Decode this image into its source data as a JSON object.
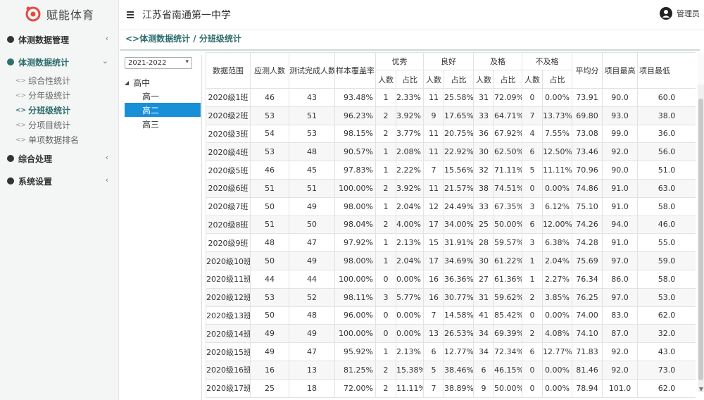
{
  "app": {
    "name": "赋能体育"
  },
  "header": {
    "school": "江苏省南通第一中学",
    "user": "管理员"
  },
  "menu": [
    {
      "label": "体测数据管理",
      "expanded": false,
      "active": false
    },
    {
      "label": "体测数据统计",
      "expanded": true,
      "active": true,
      "children": [
        {
          "label": "综合性统计",
          "active": false
        },
        {
          "label": "分年级统计",
          "active": false
        },
        {
          "label": "分班级统计",
          "active": true
        },
        {
          "label": "分项目统计",
          "active": false
        },
        {
          "label": "单项数据排名",
          "active": false
        }
      ]
    },
    {
      "label": "综合处理",
      "expanded": false,
      "active": false
    },
    {
      "label": "系统设置",
      "expanded": false,
      "active": false
    }
  ],
  "breadcrumb": "体测数据统计 / 分班级统计",
  "year_select": {
    "value": "2021-2022"
  },
  "tree": {
    "root": "高中",
    "nodes": [
      {
        "label": "高一",
        "selected": false
      },
      {
        "label": "高二",
        "selected": true
      },
      {
        "label": "高三",
        "selected": false
      }
    ]
  },
  "table": {
    "headers": {
      "range": "数据范围",
      "should": "应测人数",
      "done": "测试完成人数",
      "coverage": "样本覆盖率",
      "excellent": "优秀",
      "good": "良好",
      "pass": "及格",
      "fail": "不及格",
      "avg": "平均分",
      "max": "项目最高",
      "min": "项目最低",
      "count": "人数",
      "ratio": "占比"
    },
    "rows": [
      [
        "2020级1班",
        "46",
        "43",
        "93.48%",
        "1",
        "2.33%",
        "11",
        "25.58%",
        "31",
        "72.09%",
        "0",
        "0.00%",
        "73.91",
        "90.0",
        "60.0"
      ],
      [
        "2020级2班",
        "53",
        "51",
        "96.23%",
        "2",
        "3.92%",
        "9",
        "17.65%",
        "33",
        "64.71%",
        "7",
        "13.73%",
        "69.80",
        "93.0",
        "38.0"
      ],
      [
        "2020级3班",
        "54",
        "53",
        "98.15%",
        "2",
        "3.77%",
        "11",
        "20.75%",
        "36",
        "67.92%",
        "4",
        "7.55%",
        "73.08",
        "99.0",
        "36.0"
      ],
      [
        "2020级4班",
        "53",
        "48",
        "90.57%",
        "1",
        "2.08%",
        "11",
        "22.92%",
        "30",
        "62.50%",
        "6",
        "12.50%",
        "73.46",
        "92.0",
        "56.0"
      ],
      [
        "2020级5班",
        "46",
        "45",
        "97.83%",
        "1",
        "2.22%",
        "7",
        "15.56%",
        "32",
        "71.11%",
        "5",
        "11.11%",
        "70.96",
        "90.0",
        "51.0"
      ],
      [
        "2020级6班",
        "51",
        "51",
        "100.00%",
        "2",
        "3.92%",
        "11",
        "21.57%",
        "38",
        "74.51%",
        "0",
        "0.00%",
        "74.86",
        "91.0",
        "63.0"
      ],
      [
        "2020级7班",
        "50",
        "49",
        "98.00%",
        "1",
        "2.04%",
        "12",
        "24.49%",
        "33",
        "67.35%",
        "3",
        "6.12%",
        "75.10",
        "91.0",
        "58.0"
      ],
      [
        "2020级8班",
        "51",
        "50",
        "98.04%",
        "2",
        "4.00%",
        "17",
        "34.00%",
        "25",
        "50.00%",
        "6",
        "12.00%",
        "74.26",
        "94.0",
        "46.0"
      ],
      [
        "2020级9班",
        "48",
        "47",
        "97.92%",
        "1",
        "2.13%",
        "15",
        "31.91%",
        "28",
        "59.57%",
        "3",
        "6.38%",
        "74.28",
        "91.0",
        "55.0"
      ],
      [
        "2020级10班",
        "50",
        "49",
        "98.00%",
        "1",
        "2.04%",
        "17",
        "34.69%",
        "30",
        "61.22%",
        "1",
        "2.04%",
        "75.69",
        "97.0",
        "59.0"
      ],
      [
        "2020级11班",
        "44",
        "44",
        "100.00%",
        "0",
        "0.00%",
        "16",
        "36.36%",
        "27",
        "61.36%",
        "1",
        "2.27%",
        "76.34",
        "86.0",
        "58.0"
      ],
      [
        "2020级12班",
        "53",
        "52",
        "98.11%",
        "3",
        "5.77%",
        "16",
        "30.77%",
        "31",
        "59.62%",
        "2",
        "3.85%",
        "76.25",
        "97.0",
        "53.0"
      ],
      [
        "2020级13班",
        "50",
        "48",
        "96.00%",
        "0",
        "0.00%",
        "7",
        "14.58%",
        "41",
        "85.42%",
        "0",
        "0.00%",
        "74.00",
        "83.0",
        "62.0"
      ],
      [
        "2020级14班",
        "49",
        "49",
        "100.00%",
        "0",
        "0.00%",
        "13",
        "26.53%",
        "34",
        "69.39%",
        "2",
        "4.08%",
        "74.10",
        "87.0",
        "32.0"
      ],
      [
        "2020级15班",
        "49",
        "47",
        "95.92%",
        "1",
        "2.13%",
        "6",
        "12.77%",
        "34",
        "72.34%",
        "6",
        "12.77%",
        "71.83",
        "92.0",
        "43.0"
      ],
      [
        "2020级16班",
        "16",
        "13",
        "81.25%",
        "2",
        "15.38%",
        "5",
        "38.46%",
        "6",
        "46.15%",
        "0",
        "0.00%",
        "81.46",
        "92.0",
        "73.0"
      ],
      [
        "2020级17班",
        "25",
        "18",
        "72.00%",
        "2",
        "11.11%",
        "7",
        "38.89%",
        "9",
        "50.00%",
        "0",
        "0.00%",
        "78.94",
        "101.0",
        "62.0"
      ]
    ]
  },
  "icons": {
    "logo": "logo-mark-icon",
    "menu_toggle": "hamburger-icon",
    "user": "user-avatar-icon",
    "menu_bullet": "circle-bullet-icon",
    "sub_bullet": "code-arrow-icon",
    "chevron": "chevron-icon"
  },
  "colors": {
    "accent": "#2f6e6e",
    "selected": "#1890d8",
    "logo": "#e8493e"
  }
}
